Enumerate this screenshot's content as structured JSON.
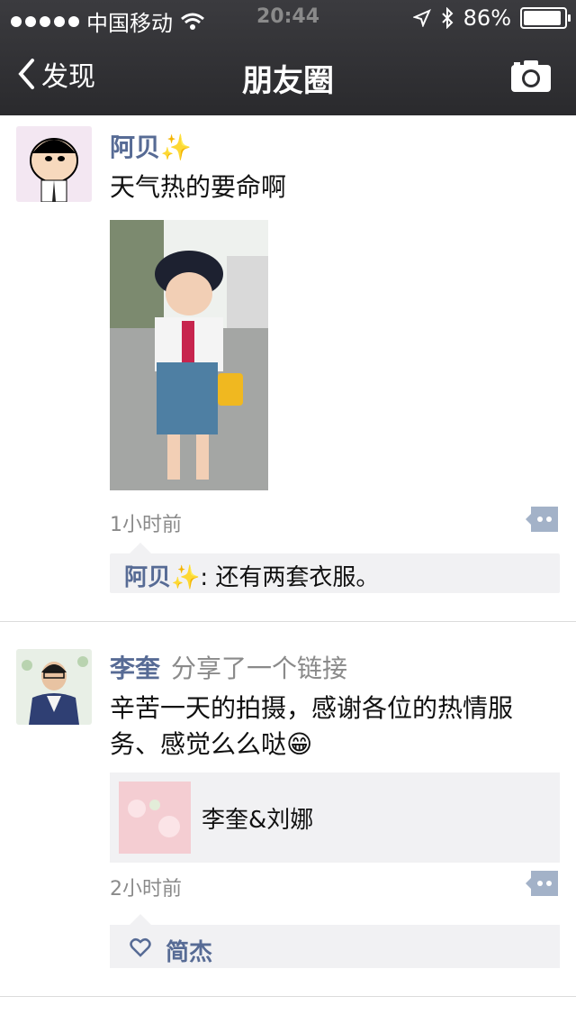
{
  "status_bar": {
    "carrier": "中国移动",
    "time": "20:44",
    "battery": "86%"
  },
  "nav": {
    "back_label": "发现",
    "title": "朋友圈"
  },
  "posts": [
    {
      "author": "阿贝✨",
      "text": "天气热的要命啊",
      "timestamp": "1小时前",
      "comments": [
        {
          "author": "阿贝✨",
          "text": ": 还有两套衣服。"
        }
      ]
    },
    {
      "author": "李奎",
      "share_label": "分享了一个链接",
      "text": "辛苦一天的拍摄，感谢各位的热情服务、感觉么么哒😁",
      "link": {
        "title": "李奎&刘娜"
      },
      "timestamp": "2小时前",
      "likes": [
        "简杰"
      ]
    }
  ],
  "colors": {
    "nav_bg": "#2e2e31",
    "link_name": "#576b95",
    "comment_bg": "#f1f1f3",
    "comment_button": "#a3b2c8"
  }
}
